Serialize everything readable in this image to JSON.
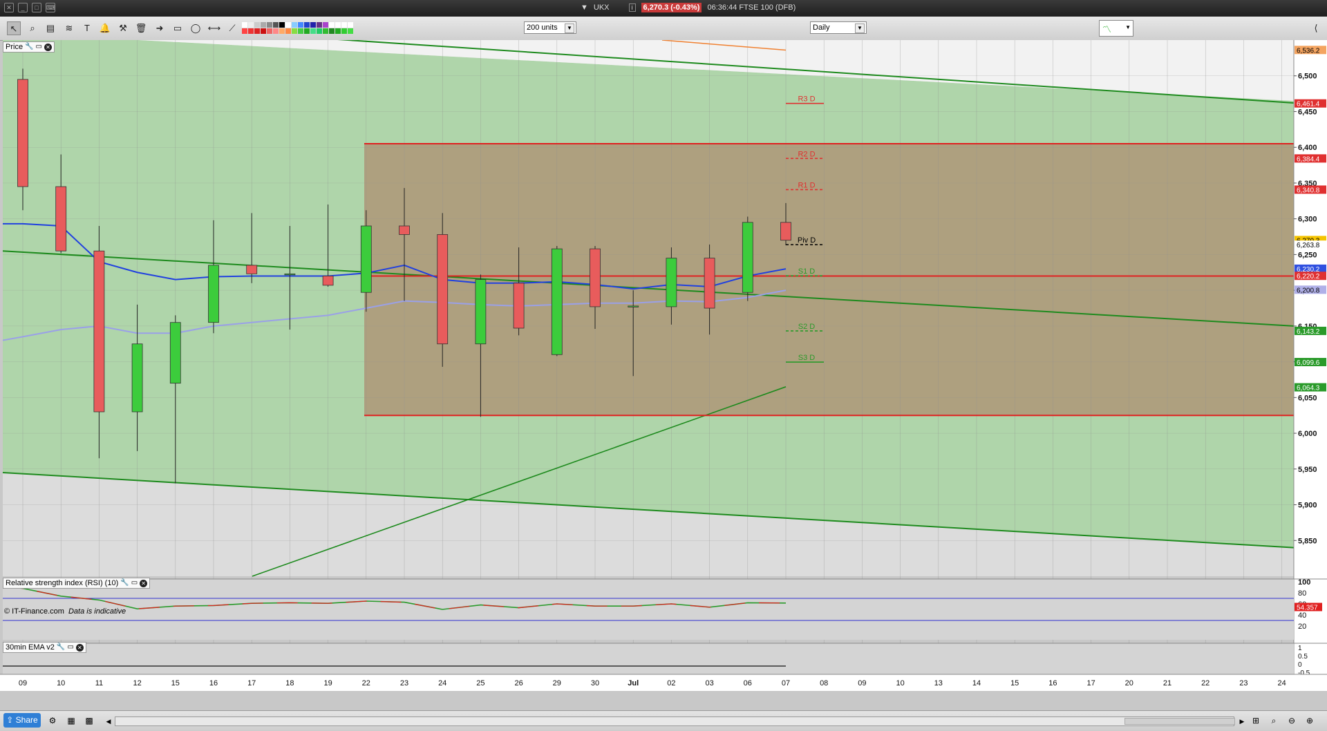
{
  "window": {
    "symbol": "UKX",
    "price_badge": "6,270.3 (-0.43%)",
    "time_label": "06:36:44 FTSE 100 (DFB)"
  },
  "toolbar": {
    "units_select": "200 units",
    "period_select": "Daily",
    "tools": [
      "pointer-icon",
      "zoom-icon",
      "chart-icon",
      "fib-icon",
      "text-icon",
      "alert-bell-icon",
      "hammer-icon",
      "trash-icon",
      "arrow-icon",
      "rectangle-icon",
      "lasso-icon",
      "horizontal-line-icon",
      "trend-line-icon"
    ]
  },
  "price_panel": {
    "title": "Price",
    "copyright": "© IT-Finance.com",
    "disclaimer": "Data is indicative",
    "y_ticks": [
      "6,500",
      "6,450",
      "6,400",
      "6,350",
      "6,300",
      "6,250",
      "6,200",
      "6,150",
      "6,100",
      "6,050",
      "6,000",
      "5,950",
      "5,900",
      "5,850"
    ],
    "right_badges": [
      {
        "text": "6,536.2",
        "bg": "#f4a460",
        "value": 6536.2
      },
      {
        "text": "6,461.4",
        "bg": "#e03030",
        "value": 6461.4
      },
      {
        "text": "6,384.4",
        "bg": "#e03030",
        "value": 6384.4
      },
      {
        "text": "6,340.8",
        "bg": "#e03030",
        "value": 6340.8
      },
      {
        "text": "6,270.3",
        "bg": "#f5c400",
        "value": 6270.3
      },
      {
        "text": "6,263.8",
        "bg": "#ffffff",
        "value": 6263.8
      },
      {
        "text": "6,230.2",
        "bg": "#3050e0",
        "value": 6230.2
      },
      {
        "text": "6,220.2",
        "bg": "#e03030",
        "value": 6220.2
      },
      {
        "text": "6,200.8",
        "bg": "#b0b0e8",
        "value": 6200.8
      },
      {
        "text": "6,143.2",
        "bg": "#2a9a2a",
        "value": 6143.2
      },
      {
        "text": "6,099.6",
        "bg": "#2a9a2a",
        "value": 6099.6
      },
      {
        "text": "6,064.3",
        "bg": "#2a9a2a",
        "value": 6064.3
      }
    ],
    "pivots": [
      {
        "label": "R3 D",
        "value": 6461.4,
        "color": "#e03030",
        "dash": false
      },
      {
        "label": "R2 D",
        "value": 6384.4,
        "color": "#e03030",
        "dash": true
      },
      {
        "label": "R1 D",
        "value": 6340.8,
        "color": "#e03030",
        "dash": true
      },
      {
        "label": "Piv D",
        "value": 6263.8,
        "color": "#000000",
        "dash": true
      },
      {
        "label": "S1 D",
        "value": 6220.2,
        "color": "#2a9a2a",
        "dash": true
      },
      {
        "label": "S2 D",
        "value": 6143.2,
        "color": "#2a9a2a",
        "dash": true
      },
      {
        "label": "S3 D",
        "value": 6099.6,
        "color": "#2a9a2a",
        "dash": false
      }
    ]
  },
  "rsi_panel": {
    "title": "Relative strength index (RSI) (10)",
    "value_badge": "54.357",
    "y_ticks": [
      "100",
      "80",
      "60",
      "40",
      "20"
    ]
  },
  "ema_panel": {
    "title": "30min EMA v2",
    "y_ticks": [
      "1",
      "0.5",
      "0",
      "-0.5"
    ]
  },
  "x_axis": {
    "labels": [
      "09",
      "10",
      "11",
      "12",
      "15",
      "16",
      "17",
      "18",
      "19",
      "22",
      "23",
      "24",
      "25",
      "26",
      "29",
      "30",
      "Jul",
      "02",
      "03",
      "06",
      "07",
      "08",
      "09",
      "10",
      "13",
      "14",
      "15",
      "16",
      "17",
      "20",
      "21",
      "22",
      "23",
      "24"
    ]
  },
  "chart_data": {
    "type": "candlestick",
    "ylim": [
      5800,
      6550
    ],
    "candles": [
      {
        "d": "09",
        "o": 6495,
        "h": 6510,
        "l": 6312,
        "c": 6345
      },
      {
        "d": "10",
        "o": 6345,
        "h": 6390,
        "l": 6252,
        "c": 6255
      },
      {
        "d": "11",
        "o": 6255,
        "h": 6290,
        "l": 5965,
        "c": 6030
      },
      {
        "d": "12",
        "o": 6030,
        "h": 6180,
        "l": 5975,
        "c": 6125
      },
      {
        "d": "15",
        "o": 6070,
        "h": 6165,
        "l": 5930,
        "c": 6155
      },
      {
        "d": "16",
        "o": 6155,
        "h": 6298,
        "l": 6140,
        "c": 6235
      },
      {
        "d": "17",
        "o": 6235,
        "h": 6308,
        "l": 6210,
        "c": 6223
      },
      {
        "d": "18",
        "o": 6223,
        "h": 6290,
        "l": 6145,
        "c": 6223
      },
      {
        "d": "19",
        "o": 6220,
        "h": 6320,
        "l": 6205,
        "c": 6207
      },
      {
        "d": "22",
        "o": 6197,
        "h": 6312,
        "l": 6170,
        "c": 6290
      },
      {
        "d": "23",
        "o": 6290,
        "h": 6343,
        "l": 6185,
        "c": 6278
      },
      {
        "d": "24",
        "o": 6278,
        "h": 6308,
        "l": 6093,
        "c": 6125
      },
      {
        "d": "25",
        "o": 6125,
        "h": 6222,
        "l": 6023,
        "c": 6215
      },
      {
        "d": "26",
        "o": 6210,
        "h": 6260,
        "l": 6137,
        "c": 6147
      },
      {
        "d": "29",
        "o": 6110,
        "h": 6262,
        "l": 6108,
        "c": 6258
      },
      {
        "d": "30",
        "o": 6258,
        "h": 6262,
        "l": 6146,
        "c": 6177
      },
      {
        "d": "Jul",
        "o": 6178,
        "h": 6200,
        "l": 6080,
        "c": 6178
      },
      {
        "d": "02",
        "o": 6177,
        "h": 6260,
        "l": 6152,
        "c": 6245
      },
      {
        "d": "03",
        "o": 6245,
        "h": 6264,
        "l": 6138,
        "c": 6175
      },
      {
        "d": "06",
        "o": 6197,
        "h": 6303,
        "l": 6185,
        "c": 6295
      },
      {
        "d": "07",
        "o": 6295,
        "h": 6322,
        "l": 6263,
        "c": 6270
      }
    ],
    "sma_blue": [
      6293,
      6290,
      6240,
      6225,
      6215,
      6219,
      6220,
      6220,
      6220,
      6224,
      6235,
      6215,
      6210,
      6210,
      6212,
      6208,
      6202,
      6208,
      6205,
      6220,
      6230
    ],
    "sma_lilac": [
      6135,
      6145,
      6150,
      6140,
      6140,
      6150,
      6155,
      6160,
      6165,
      6175,
      6185,
      6183,
      6180,
      6178,
      6180,
      6182,
      6182,
      6185,
      6184,
      6190,
      6200
    ],
    "rsi": [
      88,
      74,
      67,
      51,
      56,
      57,
      61,
      62,
      61,
      65,
      63,
      50,
      58,
      53,
      60,
      56,
      56,
      60,
      54,
      62,
      61.5
    ]
  }
}
